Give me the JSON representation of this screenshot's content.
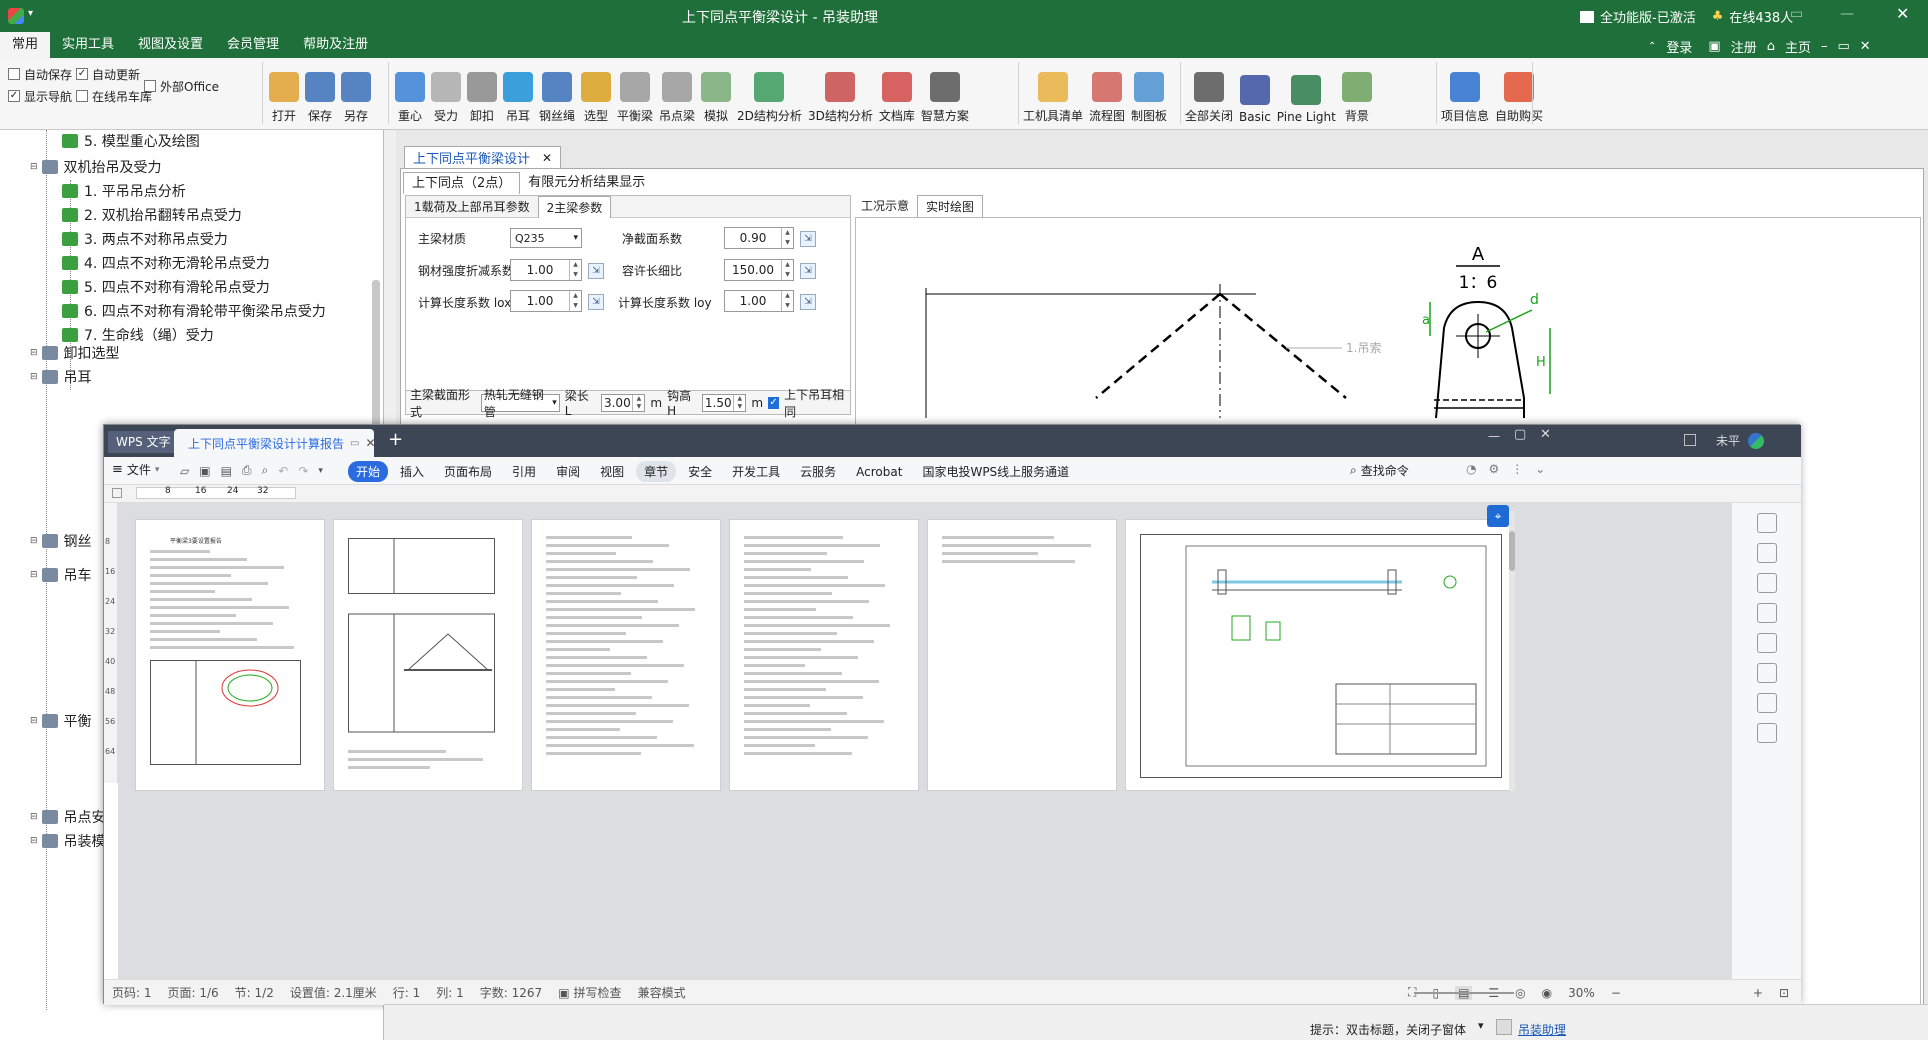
{
  "app": {
    "title": "上下同点平衡梁设计 - 吊装助理",
    "status_version": "全功能版-已激活",
    "online_count": "在线438人",
    "login": "登录",
    "register": "注册",
    "home": "主页",
    "accent_color": "#1e6f39"
  },
  "menu": {
    "tabs": [
      "常用",
      "实用工具",
      "视图及设置",
      "会员管理",
      "帮助及注册"
    ]
  },
  "ribbon": {
    "options": [
      {
        "label": "自动保存",
        "checked": false
      },
      {
        "label": "自动更新",
        "checked": true
      },
      {
        "label": "外部Office",
        "checked": false
      },
      {
        "label": "显示导航",
        "checked": true
      },
      {
        "label": "在线吊车库",
        "checked": false
      }
    ],
    "file_buttons": [
      "打开",
      "保存",
      "另存"
    ],
    "calc_buttons": [
      "重心",
      "受力",
      "卸扣",
      "吊耳",
      "钢丝绳",
      "选型",
      "平衡梁",
      "吊点梁",
      "模拟",
      "2D结构分析",
      "3D结构分析",
      "文档库",
      "智慧方案"
    ],
    "tool_buttons": [
      "工机具清单",
      "流程图",
      "制图板"
    ],
    "view_buttons": [
      "全部关闭",
      "Basic",
      "Pine Light",
      "背景"
    ],
    "info_buttons": [
      "项目信息",
      "自助购买"
    ]
  },
  "tree": {
    "items": [
      {
        "label": "5. 模型重心及绘图",
        "level": 2
      },
      {
        "label": "双机抬吊及受力",
        "level": 1
      },
      {
        "label": "1. 平吊吊点分析",
        "level": 2
      },
      {
        "label": "2. 双机抬吊翻转吊点受力",
        "level": 2
      },
      {
        "label": "3. 两点不对称吊点受力",
        "level": 2
      },
      {
        "label": "4. 四点不对称无滑轮吊点受力",
        "level": 2
      },
      {
        "label": "5. 四点不对称有滑轮吊点受力",
        "level": 2
      },
      {
        "label": "6. 四点不对称有滑轮带平衡梁吊点受力",
        "level": 2
      },
      {
        "label": "7. 生命线（绳）受力",
        "level": 2
      },
      {
        "label": "卸扣选型",
        "level": 1
      },
      {
        "label": "吊耳",
        "level": 1
      },
      {
        "label": "钢丝",
        "level": 1
      },
      {
        "label": "吊车",
        "level": 1
      },
      {
        "label": "平衡",
        "level": 1
      },
      {
        "label": "吊点安装梁设计",
        "level": 1
      },
      {
        "label": "吊装模拟",
        "level": 1
      }
    ]
  },
  "design": {
    "doc_tab": "上下同点平衡梁设计",
    "subtabs": [
      "上下同点（2点）",
      "有限元分析结果显示"
    ],
    "param_tabs": [
      "1载荷及上部吊耳参数",
      "2主梁参数"
    ],
    "main_material_label": "主梁材质",
    "main_material_value": "Q235",
    "net_section_label": "净截面系数",
    "net_section_value": "0.90",
    "strength_label": "钢材强度折减系数",
    "strength_value": "1.00",
    "slenderness_label": "容许长细比",
    "slenderness_value": "150.00",
    "calc_lox_label": "计算长度系数 lox",
    "calc_lox_value": "1.00",
    "calc_loy_label": "计算长度系数 loy",
    "calc_loy_value": "1.00",
    "section_form_label": "主梁截面形式",
    "section_form_value": "热轧无缝钢管",
    "beam_length_label": "梁长 L",
    "beam_length_value": "3.00",
    "unit_m": "m",
    "hook_height_label": "钩高H",
    "hook_height_value": "1.50",
    "same_ear_label": "上下吊耳相同",
    "same_ear_checked": true,
    "drawing_tabs": [
      "工况示意",
      "实时绘图"
    ],
    "detail_letter": "A",
    "detail_scale": "1：6",
    "dim_a": "a",
    "dim_d": "d",
    "dim_h": "H",
    "sling_label": "1.吊索"
  },
  "wps": {
    "app_tab": "WPS 文字",
    "doc_tab": "上下同点平衡梁设计计算报告",
    "menu_file": "文件",
    "menus": [
      "开始",
      "插入",
      "页面布局",
      "引用",
      "审阅",
      "视图",
      "章节",
      "安全",
      "开发工具",
      "云服务",
      "Acrobat",
      "国家电投WPS线上服务通道"
    ],
    "search": "查找命令",
    "user": "未平",
    "ruler_marks": [
      "8",
      "16",
      "24",
      "32"
    ],
    "vruler_marks": [
      "8",
      "16",
      "24",
      "32",
      "40",
      "48",
      "56",
      "64"
    ],
    "page1_title": "平衡梁3要设置报告",
    "status": {
      "page": "页码: 1",
      "pages": "页面: 1/6",
      "section": "节: 1/2",
      "setting": "设置值: 2.1厘米",
      "row": "行: 1",
      "col": "列: 1",
      "words": "字数: 1267",
      "spell": "拼写检查",
      "compat": "兼容模式",
      "zoom": "30%"
    }
  },
  "statusbar": {
    "hint": "提示：双击标题，关闭子窗体",
    "link": "吊装助理"
  }
}
